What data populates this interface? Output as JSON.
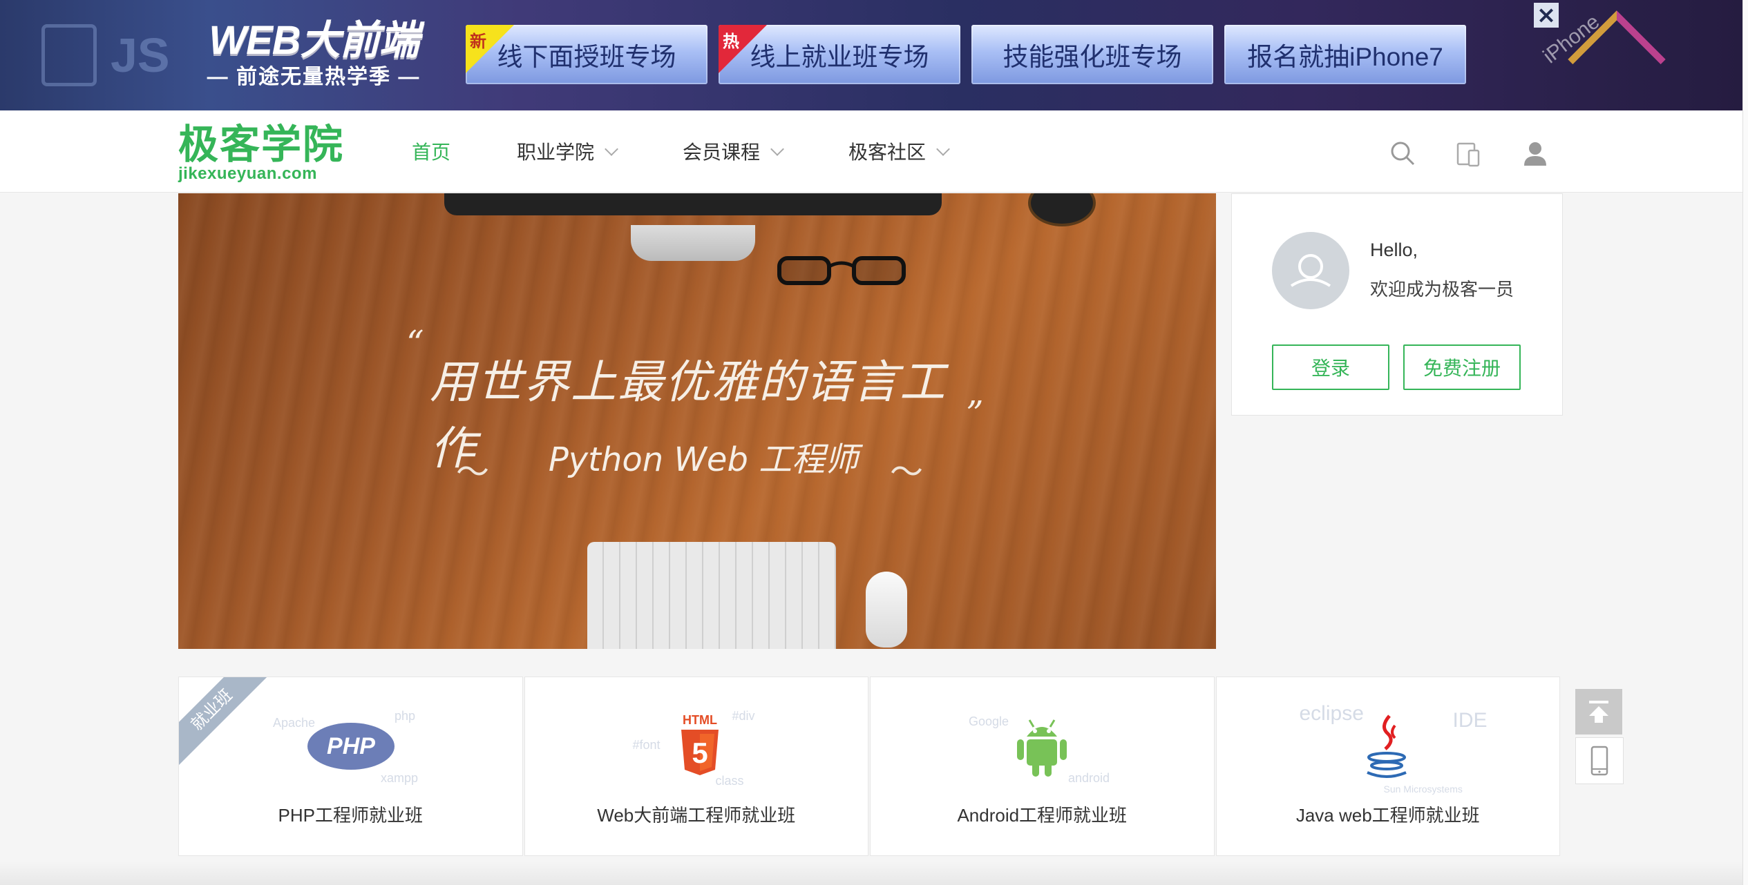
{
  "promo": {
    "deco_text": "JS",
    "logo_title": "WEB大前端",
    "logo_subtitle": "— 前途无量热学季 —",
    "buttons": [
      {
        "label": "线下面授班专场",
        "badge": "新"
      },
      {
        "label": "线上就业班专场",
        "badge": "热"
      },
      {
        "label": "技能强化班专场",
        "badge": ""
      },
      {
        "label": "报名就抽iPhone7",
        "badge": ""
      }
    ],
    "close_icon": "close-icon",
    "side_text": "iPhone"
  },
  "header": {
    "logo_cn": "极客学院",
    "logo_en": "jikexueyuan.com",
    "nav": [
      {
        "label": "首页",
        "active": true
      },
      {
        "label": "职业学院",
        "dropdown": true
      },
      {
        "label": "会员课程",
        "dropdown": true
      },
      {
        "label": "极客社区",
        "dropdown": true
      }
    ],
    "icons": [
      "search-icon",
      "mobile-devices-icon",
      "user-icon"
    ]
  },
  "hero": {
    "quote_open": "“",
    "quote_close": "”",
    "title": "用世界上最优雅的语言工作",
    "subtitle": "Python Web 工程师"
  },
  "welcome": {
    "hello": "Hello,",
    "message": "欢迎成为极客一员",
    "login_label": "登录",
    "register_label": "免费注册"
  },
  "courses": {
    "ribbon": "就业班",
    "items": [
      {
        "label": "PHP工程师就业班",
        "logo": "PHP",
        "tags": [
          "Apache",
          "php",
          "xampp"
        ]
      },
      {
        "label": "Web大前端工程师就业班",
        "logo": "HTML",
        "tags": [
          "#div",
          "#font",
          "class"
        ]
      },
      {
        "label": "Android工程师就业班",
        "logo": "android",
        "tags": [
          "Google",
          "android"
        ]
      },
      {
        "label": "Java web工程师就业班",
        "logo": "java",
        "tags": [
          "eclipse",
          "IDE",
          "Sun Microsystems"
        ]
      }
    ]
  },
  "side_tools": [
    "back-to-top-icon",
    "mobile-icon"
  ],
  "colors": {
    "brand_green": "#35b558",
    "promo_bg": "#2f3567",
    "card_border": "#e6e6e6"
  }
}
